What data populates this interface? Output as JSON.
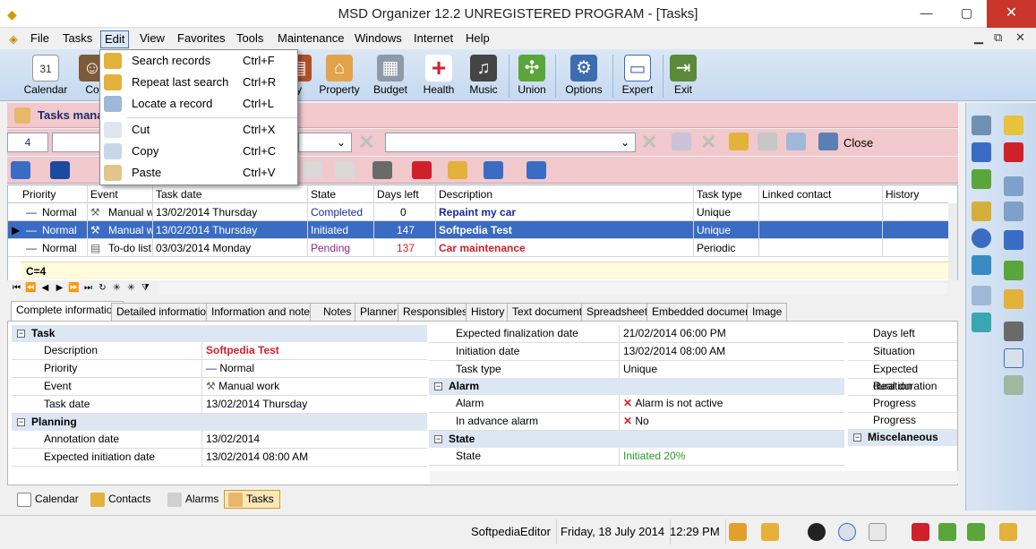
{
  "window": {
    "title": "MSD Organizer 12.2 UNREGISTERED PROGRAM - [Tasks]",
    "min": "—",
    "max": "▢",
    "close": "✕"
  },
  "menubar": {
    "items": [
      "File",
      "Tasks",
      "Edit",
      "View",
      "Favorites",
      "Tools",
      "Maintenance",
      "Windows",
      "Internet",
      "Help"
    ],
    "mdi_min": "▁",
    "mdi_restore": "⧉",
    "mdi_close": "✕"
  },
  "toolbar": {
    "items": [
      "Calendar",
      "Co",
      "ry",
      "Property",
      "Budget",
      "Health",
      "Music",
      "Union",
      "Options",
      "Expert",
      "Exit"
    ]
  },
  "module": {
    "title": "Tasks mana"
  },
  "filter": {
    "number": "4",
    "close_label": "Close"
  },
  "grid": {
    "columns": [
      "Priority",
      "Event",
      "Task date",
      "State",
      "Days left",
      "Description",
      "Task type",
      "Linked contact",
      "History"
    ],
    "rows": [
      {
        "priority": "Normal",
        "event": "Manual w",
        "date": "13/02/2014 Thursday",
        "state": "Completed",
        "days": "0",
        "desc": "Repaint my car",
        "type": "Unique"
      },
      {
        "priority": "Normal",
        "event": "Manual w",
        "date": "13/02/2014 Thursday",
        "state": "Initiated",
        "days": "147",
        "desc": "Softpedia Test",
        "type": "Unique"
      },
      {
        "priority": "Normal",
        "event": "To-do list",
        "date": "03/03/2014 Monday",
        "state": "Pending",
        "days": "137",
        "desc": "Car maintenance",
        "type": "Periodic"
      }
    ],
    "count": "C=4"
  },
  "tabs": [
    "Complete information",
    "Detailed information",
    "Information and notes",
    "Notes",
    "Planner",
    "Responsibles",
    "History",
    "Text document",
    "Spreadsheet",
    "Embedded document",
    "Image"
  ],
  "detail": {
    "task_section": "Task",
    "description_label": "Description",
    "description_value": "Softpedia Test",
    "priority_label": "Priority",
    "priority_value": "Normal",
    "event_label": "Event",
    "event_value": "Manual work",
    "taskdate_label": "Task date",
    "taskdate_value": "13/02/2014 Thursday",
    "planning_section": "Planning",
    "annotation_label": "Annotation date",
    "annotation_value": "13/02/2014",
    "expinit_label": "Expected initiation date",
    "expinit_value": "13/02/2014 08:00 AM",
    "expfinal_label": "Expected finalization date",
    "expfinal_value": "21/02/2014 06:00 PM",
    "initdate_label": "Initiation date",
    "initdate_value": "13/02/2014 08:00 AM",
    "tasktype_label": "Task type",
    "tasktype_value": "Unique",
    "alarm_section": "Alarm",
    "alarm_label": "Alarm",
    "alarm_value": "Alarm is not active",
    "advance_label": "In advance alarm",
    "advance_value": "No",
    "state_section": "State",
    "state_label": "State",
    "state_value": "Initiated 20%",
    "right_items": [
      "Days left",
      "Situation",
      "Expected duration",
      "Real duration",
      "Progress",
      "Progress"
    ],
    "misc_section": "Miscelaneous"
  },
  "bottomtabs": [
    "Calendar",
    "Contacts",
    "Alarms",
    "Tasks"
  ],
  "status": {
    "user": "SoftpediaEditor",
    "date": "Friday, 18 July 2014",
    "time": "12:29 PM"
  },
  "dropdown": {
    "items": [
      {
        "label": "Search records",
        "shortcut": "Ctrl+F"
      },
      {
        "label": "Repeat last search",
        "shortcut": "Ctrl+R"
      },
      {
        "label": "Locate a record",
        "shortcut": "Ctrl+L"
      },
      {
        "label": "Cut",
        "shortcut": "Ctrl+X"
      },
      {
        "label": "Copy",
        "shortcut": "Ctrl+C"
      },
      {
        "label": "Paste",
        "shortcut": "Ctrl+V"
      }
    ]
  },
  "colors": {
    "accent": "#3a6cc4",
    "pink": "#f1c8cc",
    "red": "#d0202a",
    "blue_text": "#1c2a9b"
  }
}
